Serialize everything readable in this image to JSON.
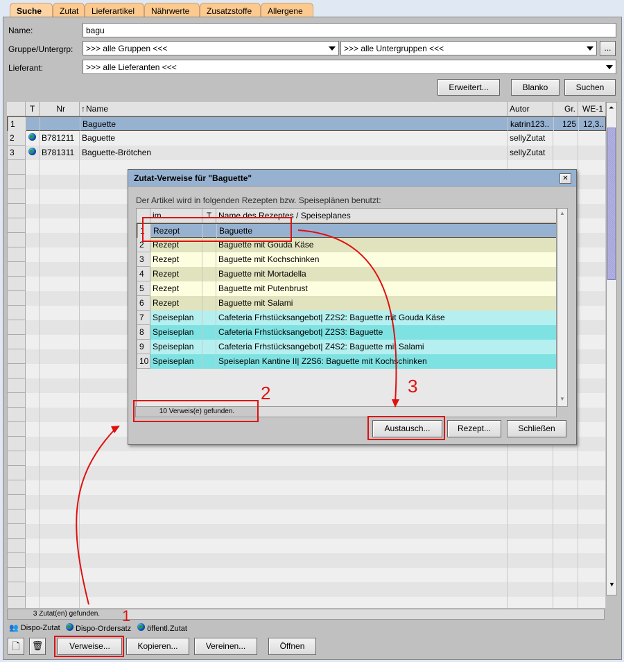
{
  "tabs": [
    {
      "label": "Suche",
      "active": true
    },
    {
      "label": "Zutat"
    },
    {
      "label": "Lieferartikel"
    },
    {
      "label": "Nährwerte"
    },
    {
      "label": "Zusatzstoffe"
    },
    {
      "label": "Allergene"
    }
  ],
  "form": {
    "name_label": "Name:",
    "name_value": "bagu",
    "group_label": "Gruppe/Untergrp:",
    "group_value": ">>> alle Gruppen <<<",
    "subgroup_value": ">>> alle Untergruppen <<<",
    "more_button": "...",
    "supplier_label": "Lieferant:",
    "supplier_value": ">>> alle Lieferanten <<<"
  },
  "search_buttons": {
    "advanced": "Erweitert...",
    "blank": "Blanko",
    "search": "Suchen"
  },
  "main_table": {
    "headers": {
      "t": "T",
      "nr": "Nr",
      "name": "Name",
      "author": "Autor",
      "gr": "Gr.",
      "we": "WE-1"
    },
    "rows": [
      {
        "num": "1",
        "globe": false,
        "nr": "",
        "name": "Baguette",
        "author": "katrin123..",
        "gr": "125",
        "we": "12,3..",
        "selected": true
      },
      {
        "num": "2",
        "globe": true,
        "nr": "B781211",
        "name": "Baguette",
        "author": "sellyZutat",
        "gr": "",
        "we": ""
      },
      {
        "num": "3",
        "globe": true,
        "nr": "B781311",
        "name": "Baguette-Brötchen",
        "author": "sellyZutat",
        "gr": "",
        "we": ""
      }
    ],
    "status": "3  Zutat(en) gefunden."
  },
  "legend": {
    "dispo_zutat": "Dispo-Zutat",
    "dispo_ordersatz": "Dispo-Ordersatz",
    "public": "öffentl.Zutat"
  },
  "bottom_buttons": {
    "references": "Verweise...",
    "copy": "Kopieren...",
    "merge": "Vereinen...",
    "open": "Öffnen"
  },
  "dialog": {
    "title": "Zutat-Verweise für \"Baguette\"",
    "close": "✕",
    "description": "Der Artikel wird in folgenden Rezepten bzw. Speiseplänen benutzt:",
    "headers": {
      "im": "im",
      "t": "T",
      "name": "Name des Rezeptes / Speiseplanes"
    },
    "rows": [
      {
        "num": "1",
        "im": "Rezept",
        "name": "Baguette",
        "color": "#97b2d0"
      },
      {
        "num": "2",
        "im": "Rezept",
        "name": "Baguette mit Gouda Käse",
        "color": "#e0e3bd"
      },
      {
        "num": "3",
        "im": "Rezept",
        "name": "Baguette mit Kochschinken",
        "color": "#fdfedf"
      },
      {
        "num": "4",
        "im": "Rezept",
        "name": "Baguette mit Mortadella",
        "color": "#e0e3bd"
      },
      {
        "num": "5",
        "im": "Rezept",
        "name": "Baguette mit Putenbrust",
        "color": "#fdfedf"
      },
      {
        "num": "6",
        "im": "Rezept",
        "name": "Baguette mit Salami",
        "color": "#e0e3bd"
      },
      {
        "num": "7",
        "im": "Speiseplan",
        "name": "Cafeteria Frhstücksangebot| Z2S2: Baguette mit Gouda Käse",
        "color": "#b6efef"
      },
      {
        "num": "8",
        "im": "Speiseplan",
        "name": "Cafeteria Frhstücksangebot| Z2S3: Baguette",
        "color": "#7fe2e2"
      },
      {
        "num": "9",
        "im": "Speiseplan",
        "name": "Cafeteria Frhstücksangebot| Z4S2: Baguette mit Salami",
        "color": "#b6efef"
      },
      {
        "num": "10",
        "im": "Speiseplan",
        "name": "Speiseplan Kantine II| Z2S6: Baguette mit Kochschinken",
        "color": "#7fe2e2"
      }
    ],
    "status": "10  Verweis(e) gefunden.",
    "buttons": {
      "exchange": "Austausch...",
      "recipe": "Rezept...",
      "close": "Schließen"
    }
  },
  "annotations": [
    "1",
    "2",
    "3"
  ],
  "colors": {
    "accent_red": "#e01010",
    "selected": "#97b2d0",
    "tab": "#fcc98f"
  }
}
